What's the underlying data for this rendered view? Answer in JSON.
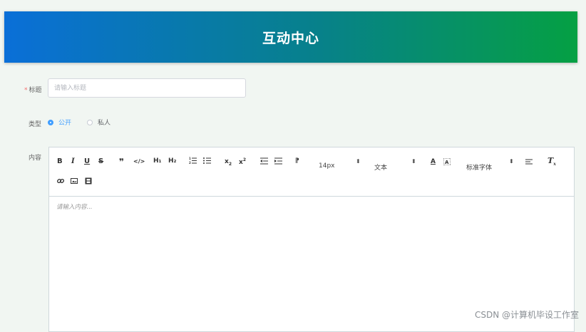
{
  "header": {
    "title": "互动中心"
  },
  "form": {
    "title_label": "标题",
    "title_placeholder": "请输入标题",
    "type_label": "类型",
    "type_options": [
      {
        "label": "公开",
        "selected": true
      },
      {
        "label": "私人",
        "selected": false
      }
    ],
    "content_label": "内容"
  },
  "editor": {
    "toolbar": {
      "bold": "B",
      "italic": "I",
      "underline": "U",
      "strike": "S",
      "blockquote": "❞",
      "code": "</>",
      "h1": "H₁",
      "h2": "H₂",
      "size": "14px",
      "header": "文本",
      "font": "标准字体",
      "clean": "Tx"
    },
    "placeholder": "请输入内容..."
  },
  "watermark": "CSDN @计算机毕设工作室",
  "colors": {
    "accent": "#409eff",
    "header_start": "#0a6fd8",
    "header_end": "#05a043",
    "required": "#f56c6c"
  }
}
